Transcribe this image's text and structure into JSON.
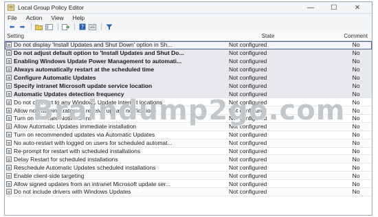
{
  "window": {
    "title": "Local Group Policy Editor",
    "minimize_glyph": "—",
    "maximize_glyph": "☐",
    "close_glyph": "✕"
  },
  "menu": [
    "File",
    "Action",
    "View",
    "Help"
  ],
  "toolbar": {
    "icons": [
      "back-arrow-icon",
      "forward-arrow-icon",
      "folder-up-icon",
      "show-hide-tree-icon",
      "export-list-icon",
      "help-icon",
      "properties-icon",
      "filter-icon"
    ]
  },
  "columns": {
    "setting": "Setting",
    "state": "State",
    "comment": "Comment"
  },
  "rows": [
    {
      "setting": "Do not display 'Install Updates and Shut Down' option in Sh...",
      "state": "Not configured",
      "comment": "No"
    },
    {
      "setting": "Do not adjust default option to 'Install Updates and Shut Do...",
      "state": "Not configured",
      "comment": "No"
    },
    {
      "setting": "Enabling Windows Update Power Management to automati...",
      "state": "Not configured",
      "comment": "No"
    },
    {
      "setting": "Always automatically restart at the scheduled time",
      "state": "Not configured",
      "comment": "No"
    },
    {
      "setting": "Configure Automatic Updates",
      "state": "Not configured",
      "comment": "No"
    },
    {
      "setting": "Specify intranet Microsoft update service location",
      "state": "Not configured",
      "comment": "No"
    },
    {
      "setting": "Automatic Updates detection frequency",
      "state": "Not configured",
      "comment": "No"
    },
    {
      "setting": "Do not connect to any Windows Update Internet locations",
      "state": "Not configured",
      "comment": "No"
    },
    {
      "setting": "Allow non-administrators to receive update notifications",
      "state": "Not configured",
      "comment": "No"
    },
    {
      "setting": "Turn on Software Notifications",
      "state": "Not configured",
      "comment": "No"
    },
    {
      "setting": "Allow Automatic Updates immediate installation",
      "state": "Not configured",
      "comment": "No"
    },
    {
      "setting": "Turn on recommended updates via Automatic Updates",
      "state": "Not configured",
      "comment": "No"
    },
    {
      "setting": "No auto-restart with logged on users for scheduled automat...",
      "state": "Not configured",
      "comment": "No"
    },
    {
      "setting": "Re-prompt for restart with scheduled installations",
      "state": "Not configured",
      "comment": "No"
    },
    {
      "setting": "Delay Restart for scheduled installations",
      "state": "Not configured",
      "comment": "No"
    },
    {
      "setting": "Reschedule Automatic Updates scheduled installations",
      "state": "Not configured",
      "comment": "No"
    },
    {
      "setting": "Enable client-side targeting",
      "state": "Not configured",
      "comment": "No"
    },
    {
      "setting": "Allow signed updates from an intranet Microsoft update ser...",
      "state": "Not configured",
      "comment": "No"
    },
    {
      "setting": "Do not include drivers with Windows Updates",
      "state": "Not configured",
      "comment": "No"
    }
  ],
  "watermark": "Braindump2go.com",
  "colors": {
    "selection_border": "#4b5f8c",
    "accent": "#1e64b4"
  }
}
